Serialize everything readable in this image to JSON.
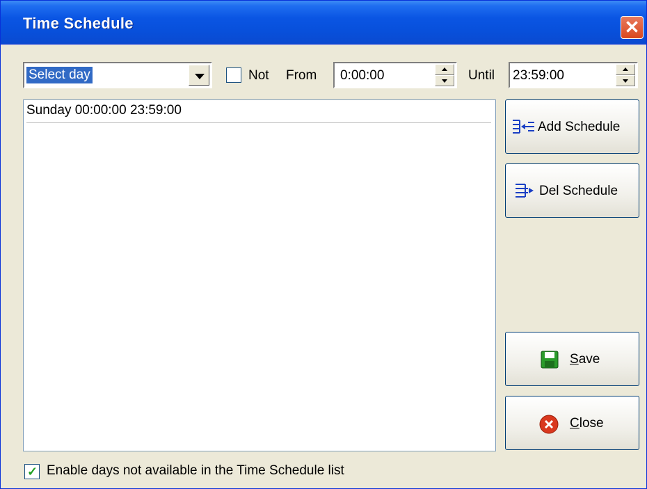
{
  "window": {
    "title": "Time Schedule",
    "close_glyph": "✕"
  },
  "controls": {
    "day_select": {
      "value": "Select day"
    },
    "not_checkbox": {
      "label": "Not",
      "checked": false
    },
    "from": {
      "label": "From",
      "value": "0:00:00"
    },
    "until": {
      "label": "Until",
      "value": "23:59:00"
    }
  },
  "schedule_list": {
    "items": [
      "Sunday 00:00:00 23:59:00"
    ]
  },
  "buttons": {
    "add_schedule": {
      "label": "Add Schedule",
      "icon": "add-schedule-icon"
    },
    "del_schedule": {
      "label": "Del Schedule",
      "icon": "del-schedule-icon"
    },
    "save": {
      "label_underlined": "S",
      "label_rest": "ave",
      "icon": "floppy-disk-icon"
    },
    "close": {
      "label_underlined": "C",
      "label_rest": "lose",
      "icon": "close-circle-icon"
    }
  },
  "enable_days": {
    "label": "Enable days not available in the Time Schedule list",
    "checked": true
  },
  "colors": {
    "titlebar": "#0a55e3",
    "face": "#ece9d8",
    "selection": "#316ac5"
  }
}
